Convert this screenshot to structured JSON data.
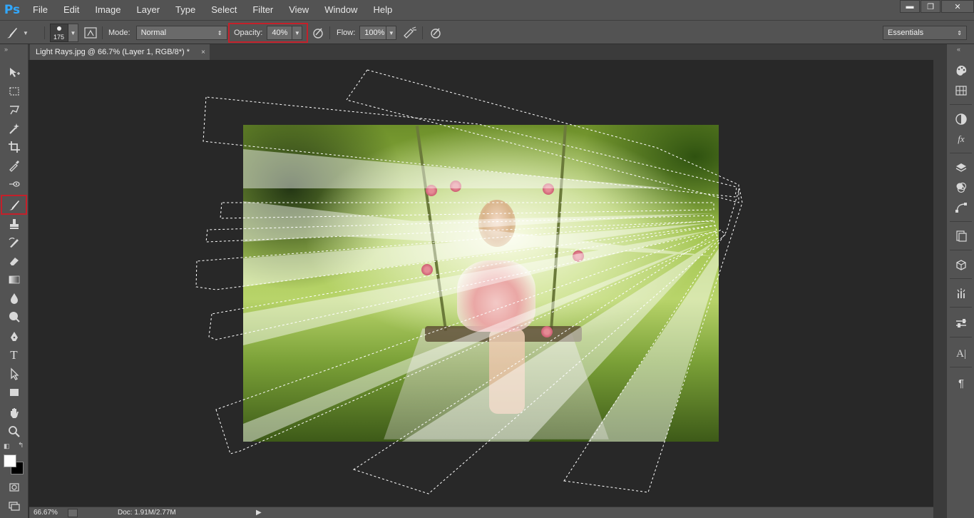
{
  "app": {
    "logo": "Ps"
  },
  "menu": [
    "File",
    "Edit",
    "Image",
    "Layer",
    "Type",
    "Select",
    "Filter",
    "View",
    "Window",
    "Help"
  ],
  "window_controls": {
    "minimize": "▬",
    "restore": "❐",
    "close": "✕"
  },
  "options": {
    "brush_size": "175",
    "mode_label": "Mode:",
    "mode_value": "Normal",
    "opacity_label": "Opacity:",
    "opacity_value": "40%",
    "flow_label": "Flow:",
    "flow_value": "100%",
    "workspace": "Essentials"
  },
  "document": {
    "tab_title": "Light Rays.jpg @ 66.7% (Layer 1, RGB/8*) *",
    "close": "×"
  },
  "tools": [
    "move-tool",
    "marquee-tool",
    "lasso-tool",
    "magic-wand-tool",
    "crop-tool",
    "eyedropper-tool",
    "spot-healing-tool",
    "brush-tool",
    "clone-stamp-tool",
    "history-brush-tool",
    "eraser-tool",
    "gradient-tool",
    "blur-tool",
    "dodge-tool",
    "pen-tool",
    "type-tool",
    "path-selection-tool",
    "rectangle-tool",
    "hand-tool",
    "zoom-tool"
  ],
  "type_tool_glyph": "T",
  "colors": {
    "foreground": "#ffffff",
    "background": "#000000",
    "highlight": "#c4202a"
  },
  "right_panel": [
    "color-panel-icon",
    "swatches-icon",
    "adjustments-icon",
    "styles-icon",
    "layers-icon",
    "channels-icon",
    "paths-icon",
    "history-icon",
    "properties-icon",
    "brush-presets-icon",
    "tool-presets-icon",
    "character-icon",
    "paragraph-icon"
  ],
  "right_panel_glyphs": {
    "character": "A|",
    "paragraph": "¶",
    "fx": "fx"
  },
  "status": {
    "zoom": "66.67%",
    "doc_info": "Doc: 1.91M/2.77M",
    "arrow": "▶"
  }
}
